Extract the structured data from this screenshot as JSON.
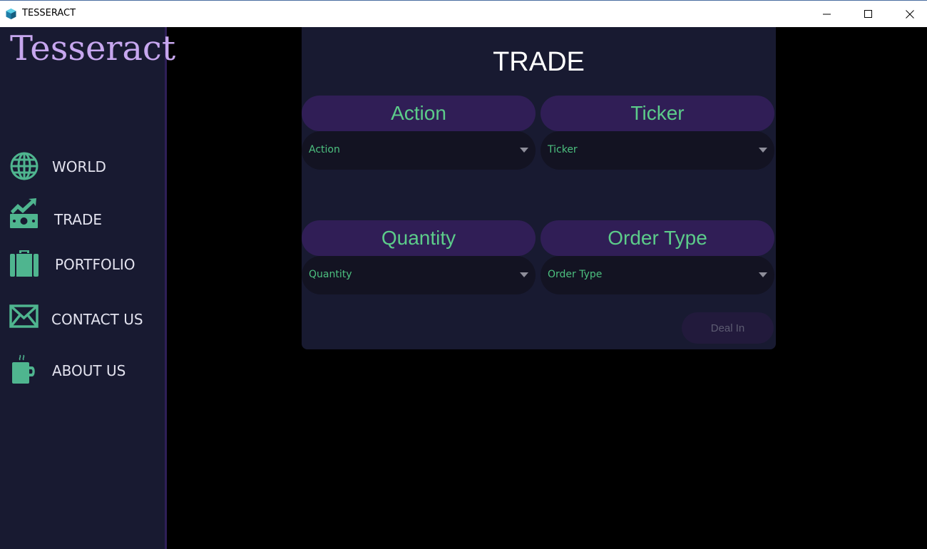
{
  "window": {
    "title": "TESSERACT"
  },
  "sidebar": {
    "logo": "Tesseract",
    "items": [
      {
        "label": "WORLD",
        "icon": "globe-icon"
      },
      {
        "label": "TRADE",
        "icon": "chart-money-icon"
      },
      {
        "label": "PORTFOLIO",
        "icon": "briefcase-icon"
      },
      {
        "label": "CONTACT  US",
        "icon": "envelope-icon"
      },
      {
        "label": "ABOUT US",
        "icon": "coffee-cup-icon"
      }
    ]
  },
  "trade": {
    "title": "TRADE",
    "fields": [
      {
        "header": "Action",
        "value": "Action"
      },
      {
        "header": "Ticker",
        "value": "Ticker"
      },
      {
        "header": "Quantity",
        "value": "Quantity"
      },
      {
        "header": "Order Type",
        "value": "Order Type"
      }
    ],
    "submit_label": "Deal In"
  },
  "colors": {
    "sidebar_bg": "#181a31",
    "panel_bg": "#181a31",
    "accent_green": "#5ccc8a",
    "header_purple": "#301e56",
    "logo_lilac": "#c7a7ef"
  }
}
